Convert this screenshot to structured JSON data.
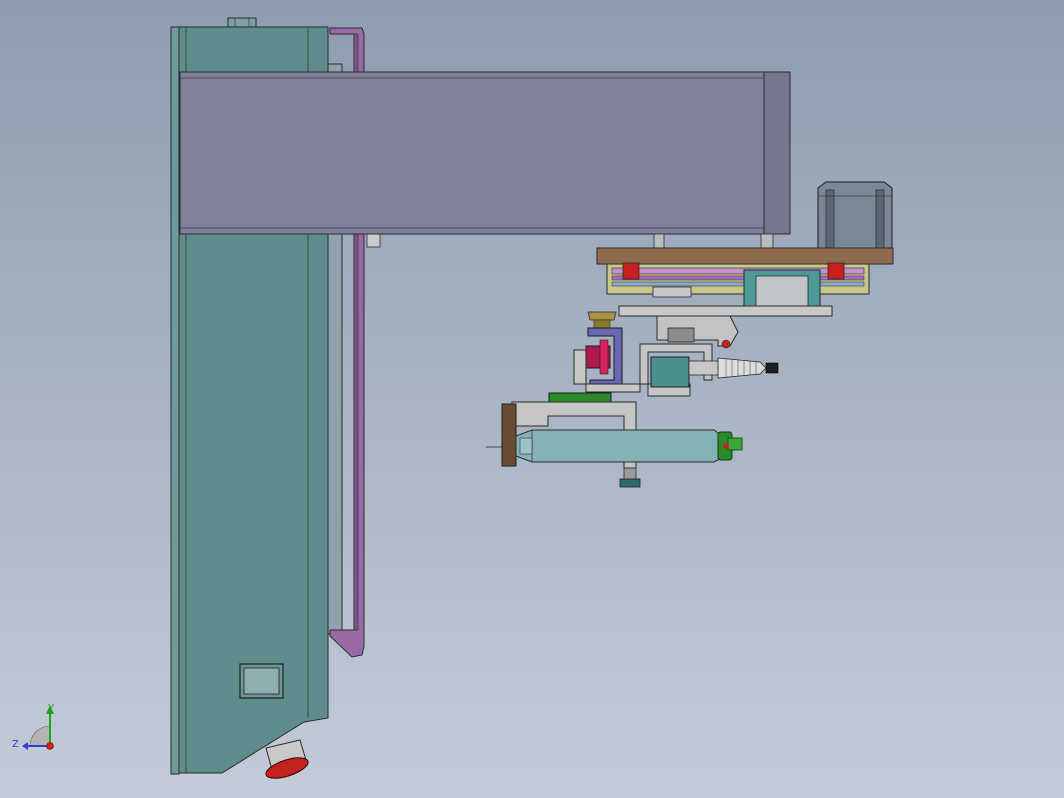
{
  "view": {
    "background_top": "#8e9cb0",
    "background_bottom": "#c3ccd8"
  },
  "triad": {
    "y_label": "Y",
    "z_label": "Z",
    "y_color": "#1fa31f",
    "x_color": "#d01f1f",
    "z_color": "#2f3fd0"
  },
  "colors": {
    "column": "#5f8d8e",
    "arm": "#81809a",
    "side_rail": "#9a6aa6",
    "plate": "#8e6a4f",
    "motor": "#7a8794",
    "grey_part": "#a7a7a7",
    "teal_part": "#4d8f8d",
    "red_part": "#c82020",
    "green_part": "#2a8a2a",
    "roller": "#85b3b5"
  }
}
